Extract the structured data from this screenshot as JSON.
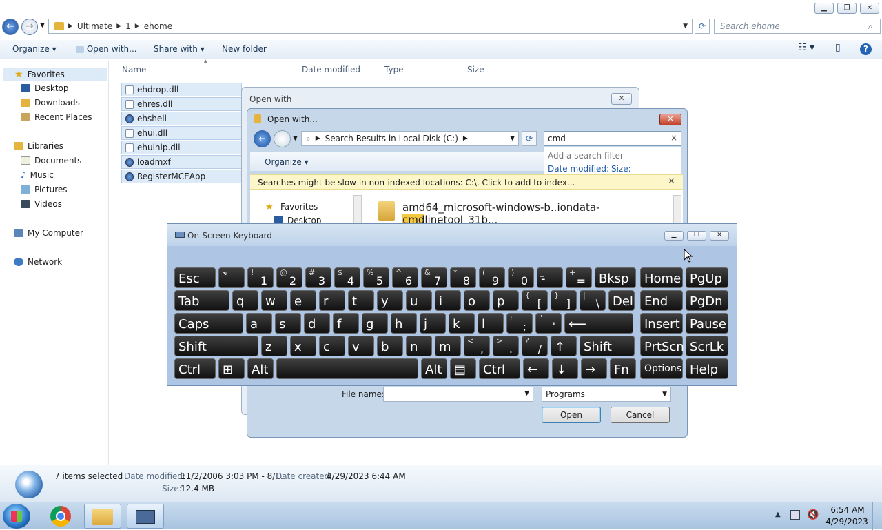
{
  "explorer": {
    "breadcrumb": [
      "Ultimate",
      "1",
      "ehome"
    ],
    "search_placeholder": "Search ehome",
    "toolbar": {
      "organize": "Organize",
      "open_with": "Open with...",
      "share_with": "Share with",
      "new_folder": "New folder"
    },
    "nav": {
      "favorites": "Favorites",
      "desktop": "Desktop",
      "downloads": "Downloads",
      "recent": "Recent Places",
      "libraries": "Libraries",
      "documents": "Documents",
      "music": "Music",
      "pictures": "Pictures",
      "videos": "Videos",
      "computer": "My Computer",
      "network": "Network"
    },
    "columns": {
      "name": "Name",
      "date": "Date modified",
      "type": "Type",
      "size": "Size"
    },
    "files": [
      {
        "name": "ehdrop.dll",
        "icon": "dll-icon"
      },
      {
        "name": "ehres.dll",
        "icon": "dll-icon"
      },
      {
        "name": "ehshell",
        "icon": "app-icon"
      },
      {
        "name": "ehui.dll",
        "icon": "dll-icon"
      },
      {
        "name": "ehuihlp.dll",
        "icon": "dll-icon"
      },
      {
        "name": "loadmxf",
        "icon": "app-icon"
      },
      {
        "name": "RegisterMCEApp",
        "icon": "app-icon"
      }
    ],
    "details": {
      "selected": "7 items selected",
      "date_modified_label": "Date modified:",
      "date_modified": "11/2/2006 3:03 PM - 8/1...",
      "date_created_label": "Date created:",
      "date_created": "4/29/2023 6:44 AM",
      "size_label": "Size:",
      "size": "12.4 MB"
    }
  },
  "open_with_back": {
    "title": "Open with"
  },
  "open_with_dialog": {
    "title": "Open with...",
    "location": "Search Results in Local Disk (C:)",
    "search_value": "cmd",
    "filter_hint": "Add a search filter",
    "filter_date": "Date modified:",
    "filter_size": "Size:",
    "organize": "Organize",
    "infobar": "Searches might be slow in non-indexed locations: C:\\. Click to add to index...",
    "nav_favorites": "Favorites",
    "nav_desktop": "Desktop",
    "result_pre": "amd64_microsoft-windows-b..iondata-",
    "result_hl": "cmd",
    "result_post": "linetool_31b...",
    "filename_label": "File name:",
    "filetype": "Programs",
    "open": "Open",
    "cancel": "Cancel"
  },
  "osk": {
    "title": "On-Screen Keyboard",
    "rows": [
      [
        {
          "m": "Esc",
          "w": 60
        },
        {
          "s": "~",
          "m": "`",
          "w": 38
        },
        {
          "s": "!",
          "n": "1",
          "w": 38
        },
        {
          "s": "@",
          "n": "2",
          "w": 38
        },
        {
          "s": "#",
          "n": "3",
          "w": 38
        },
        {
          "s": "$",
          "n": "4",
          "w": 38
        },
        {
          "s": "%",
          "n": "5",
          "w": 38
        },
        {
          "s": "^",
          "n": "6",
          "w": 38
        },
        {
          "s": "&",
          "n": "7",
          "w": 38
        },
        {
          "s": "*",
          "n": "8",
          "w": 38
        },
        {
          "s": "(",
          "n": "9",
          "w": 38
        },
        {
          "s": ")",
          "n": "0",
          "w": 38
        },
        {
          "s": "_",
          "m": "-",
          "w": 38
        },
        {
          "s": "+",
          "n": "=",
          "w": 38
        },
        {
          "m": "Bksp",
          "w": 60
        }
      ],
      [
        {
          "m": "Tab",
          "w": 80
        },
        {
          "m": "q",
          "w": 38
        },
        {
          "m": "w",
          "w": 38
        },
        {
          "m": "e",
          "w": 38
        },
        {
          "m": "r",
          "w": 38
        },
        {
          "m": "t",
          "w": 38
        },
        {
          "m": "y",
          "w": 38
        },
        {
          "m": "u",
          "w": 38
        },
        {
          "m": "i",
          "w": 38
        },
        {
          "m": "o",
          "w": 38
        },
        {
          "m": "p",
          "w": 38
        },
        {
          "s": "{",
          "n": "[",
          "w": 38
        },
        {
          "s": "}",
          "n": "]",
          "w": 38
        },
        {
          "s": "|",
          "n": "\\",
          "w": 38
        },
        {
          "m": "Del",
          "w": 38
        }
      ],
      [
        {
          "m": "Caps",
          "w": 100
        },
        {
          "m": "a",
          "w": 38
        },
        {
          "m": "s",
          "w": 38
        },
        {
          "m": "d",
          "w": 38
        },
        {
          "m": "f",
          "w": 38
        },
        {
          "m": "g",
          "w": 38
        },
        {
          "m": "h",
          "w": 38
        },
        {
          "m": "j",
          "w": 38
        },
        {
          "m": "k",
          "w": 38
        },
        {
          "m": "l",
          "w": 38
        },
        {
          "s": ":",
          "n": ";",
          "w": 38
        },
        {
          "s": "\"",
          "n": "'",
          "w": 38
        },
        {
          "m": "⟵",
          "w": 100
        }
      ],
      [
        {
          "m": "Shift",
          "w": 122
        },
        {
          "m": "z",
          "w": 38
        },
        {
          "m": "x",
          "w": 38
        },
        {
          "m": "c",
          "w": 38
        },
        {
          "m": "v",
          "w": 38
        },
        {
          "m": "b",
          "w": 38
        },
        {
          "m": "n",
          "w": 38
        },
        {
          "m": "m",
          "w": 38
        },
        {
          "s": "<",
          "n": ",",
          "w": 38
        },
        {
          "s": ">",
          "n": ".",
          "w": 38
        },
        {
          "s": "?",
          "n": "/",
          "w": 38
        },
        {
          "m": "↑",
          "w": 38
        },
        {
          "m": "Shift",
          "w": 80
        }
      ],
      [
        {
          "m": "Ctrl",
          "w": 60
        },
        {
          "m": "⊞",
          "w": 38
        },
        {
          "m": "Alt",
          "w": 38
        },
        {
          "m": "",
          "w": 206
        },
        {
          "m": "Alt",
          "w": 38
        },
        {
          "m": "▤",
          "w": 38
        },
        {
          "m": "Ctrl",
          "w": 60
        },
        {
          "m": "←",
          "w": 38
        },
        {
          "m": "↓",
          "w": 38
        },
        {
          "m": "→",
          "w": 38
        },
        {
          "m": "Fn",
          "w": 38
        }
      ]
    ],
    "right_rows": [
      [
        {
          "m": "Home"
        },
        {
          "m": "PgUp"
        }
      ],
      [
        {
          "m": "End"
        },
        {
          "m": "PgDn"
        }
      ],
      [
        {
          "m": "Insert"
        },
        {
          "m": "Pause"
        }
      ],
      [
        {
          "m": "PrtScn"
        },
        {
          "m": "ScrLk"
        }
      ],
      [
        {
          "m": "Options",
          "small": true
        },
        {
          "m": "Help"
        }
      ]
    ]
  },
  "taskbar": {
    "time": "6:54 AM",
    "date": "4/29/2023"
  },
  "colors": {
    "accent": "#1e5aa8",
    "highlight": "#f5c842",
    "infobar": "#fcf6c8"
  }
}
